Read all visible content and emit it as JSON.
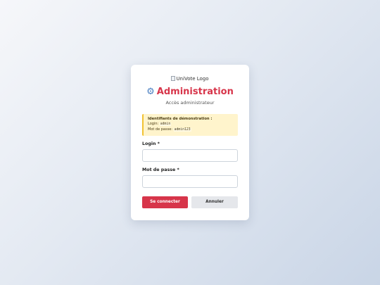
{
  "card": {
    "logo_alt": "UniVote Logo",
    "title_icon": "gear-icon",
    "title": "Administration",
    "subtitle": "Accès administrateur"
  },
  "demo": {
    "heading": "Identifiants de démonstration :",
    "login_label": "Login:",
    "login_value": "admin",
    "password_label": "Mot de passe:",
    "password_value": "admin123"
  },
  "form": {
    "login_label": "Login *",
    "login_value": "",
    "password_label": "Mot de passe *",
    "password_value": ""
  },
  "buttons": {
    "submit": "Se connecter",
    "cancel": "Annuler"
  },
  "colors": {
    "accent": "#d7354a",
    "warning_bg": "#fff4cc",
    "warning_border": "#f2c232"
  }
}
